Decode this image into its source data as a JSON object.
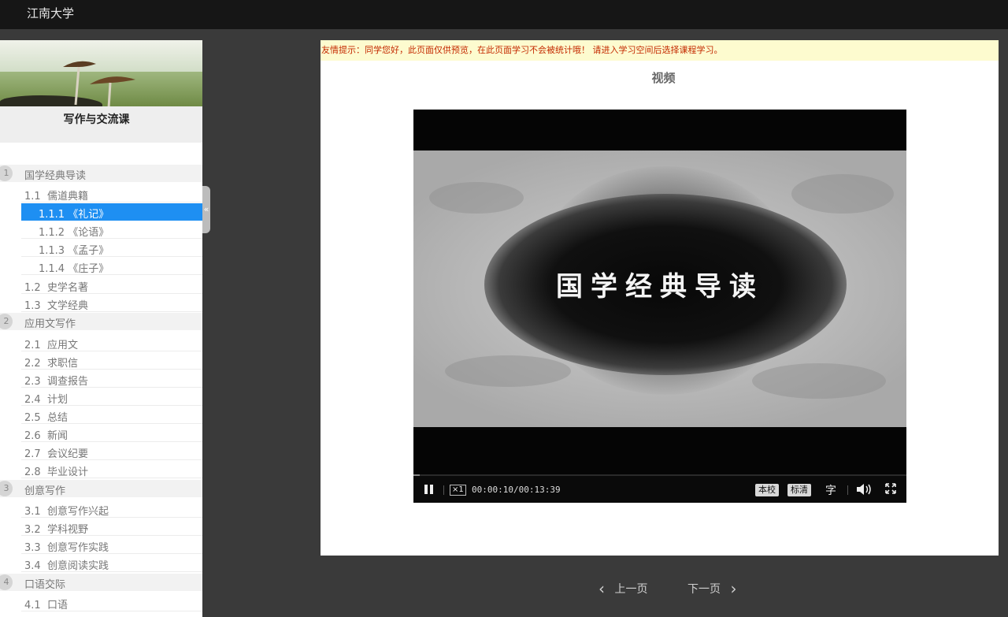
{
  "app": {
    "title": "江南大学"
  },
  "course": {
    "title": "写作与交流课"
  },
  "toc": {
    "chapters": [
      {
        "num": "1",
        "label": "国学经典导读"
      },
      {
        "num": "2",
        "label": "应用文写作"
      },
      {
        "num": "3",
        "label": "创意写作"
      },
      {
        "num": "4",
        "label": "口语交际"
      }
    ],
    "items": [
      "1.1  儒道典籍",
      "1.1.1 《礼记》",
      "1.1.2 《论语》",
      "1.1.3 《孟子》",
      "1.1.4 《庄子》",
      "1.2  史学名著",
      "1.3  文学经典",
      "2.1  应用文",
      "2.2  求职信",
      "2.3  调查报告",
      "2.4  计划",
      "2.5  总结",
      "2.6  新闻",
      "2.7  会议纪要",
      "2.8  毕业设计",
      "3.1  创意写作兴起",
      "3.2  学科视野",
      "3.3  创意写作实践",
      "3.4  创意阅读实践",
      "4.1  口语"
    ],
    "collapse_icon": "«"
  },
  "notice": "友情提示：同学您好，此页面仅供预览，在此页面学习不会被统计哦！  请进入学习空间后选择课程学习。",
  "section": {
    "title": "视频"
  },
  "player": {
    "frame_text": "国学经典导读",
    "speed": "×1",
    "time": "00:00:10/00:13:39",
    "quality_local": "本校",
    "quality_sd": "标清",
    "subtitle": "字",
    "progress": 0.012
  },
  "pager": {
    "prev": "上一页",
    "next": "下一页"
  },
  "colors": {
    "active": "#1e8ff2",
    "notice_bg": "#fdfbcf",
    "notice_text": "#c42a00"
  }
}
